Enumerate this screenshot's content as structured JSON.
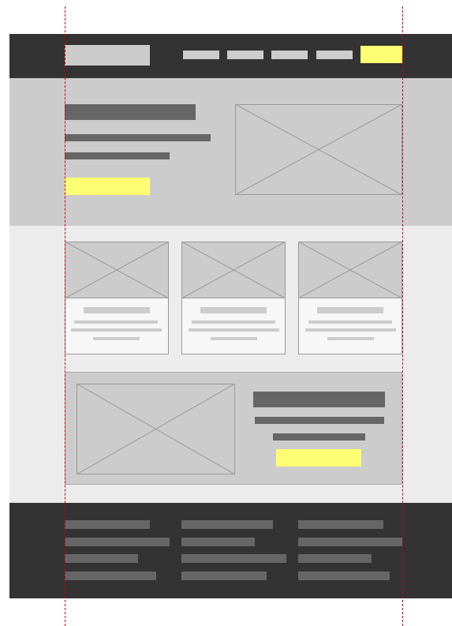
{
  "colors": {
    "dark": "#333333",
    "mid_gray": "#cccccc",
    "light_gray": "#ececec",
    "bar_gray": "#666666",
    "accent_yellow": "#fefe72",
    "guide_red": "#cc0000"
  },
  "header": {
    "logo_icon": "logo-placeholder",
    "nav_item_count": 4,
    "cta_color": "#fefe72"
  },
  "hero": {
    "image_icon": "image-placeholder-icon",
    "cta_color": "#fefe72"
  },
  "cards": {
    "count": 3,
    "image_icon": "image-placeholder-icon"
  },
  "feature": {
    "image_icon": "image-placeholder-icon",
    "cta_color": "#fefe72"
  },
  "footer": {
    "column_count": 3,
    "links_per_column": 4
  },
  "guides": {
    "count": 2,
    "style": "dashed red vertical layout guides"
  }
}
